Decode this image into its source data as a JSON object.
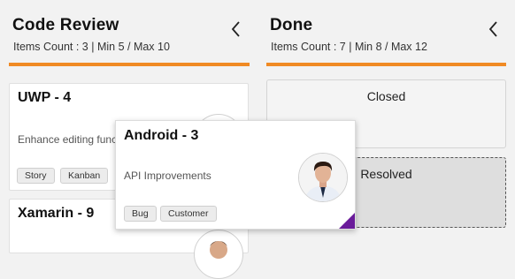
{
  "columns": [
    {
      "title": "Code Review",
      "summary": "Items Count : 3 | Min 5 / Max 10",
      "accent": "#f08a24",
      "cards": [
        {
          "title": "UWP - 4",
          "description": "Enhance editing func",
          "tags": [
            "Story",
            "Kanban"
          ]
        },
        {
          "title": "Xamarin - 9"
        }
      ]
    },
    {
      "title": "Done",
      "summary": "Items Count : 7 | Min 8 / Max 12",
      "accent": "#f08a24",
      "swimlanes": [
        {
          "label": "Closed"
        },
        {
          "label": "Resolved"
        }
      ]
    }
  ],
  "dragged_card": {
    "title": "Android - 3",
    "description": "API Improvements",
    "tags": [
      "Bug",
      "Customer"
    ],
    "indicator_color": "#6a1b9a"
  },
  "icons": {
    "collapse": "chevron-left-icon",
    "avatar": "user-avatar-icon",
    "drop_target": "dashed-drop-zone"
  }
}
